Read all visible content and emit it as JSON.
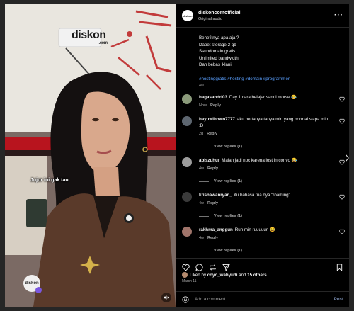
{
  "video": {
    "brand_logo_text": "diskon",
    "brand_logo_domain": ".com",
    "overlay_caption": "Jujur ini gak tau",
    "badge_text": "diskon"
  },
  "post": {
    "username": "diskoncomofficial",
    "audio": "Original audio",
    "caption_lines": [
      "Benefitnya apa aja ?",
      "Dapet storage 2 gb",
      "Ssubdomain gratis",
      "Unlimited bandwidth",
      "Dan bebas iklani"
    ],
    "hashtags": "#hostinggratis #hosting #domain #programmer",
    "caption_time": "4w"
  },
  "comments": [
    {
      "username": "bagasandri03",
      "text": "Day 1 cara belajar sandi morse 😂",
      "time": "Now",
      "reply": "Reply",
      "avatar_color": "#8a9a7a",
      "view_replies": null
    },
    {
      "username": "bayuwibowo7777",
      "text": "aku bertanya tanya min yang normal siapa min :D",
      "time": "2d",
      "reply": "Reply",
      "avatar_color": "#5d6670",
      "view_replies": "View replies (1)"
    },
    {
      "username": "abiszuhur",
      "text": "Malah jadi npc karena lost in convo 😂",
      "time": "4w",
      "reply": "Reply",
      "avatar_color": "#9c9c9c",
      "view_replies": "View replies (1)"
    },
    {
      "username": "krisnawanryan_",
      "text": "itu bahasa tua nya \"roaming\"",
      "time": "4w",
      "reply": "Reply",
      "avatar_color": "#3a3a3a",
      "view_replies": "View replies (1)"
    },
    {
      "username": "rakhma_anggun",
      "text": "Run min ruuuuun 😂",
      "time": "4w",
      "reply": "Reply",
      "avatar_color": "#a0746a",
      "view_replies": "View replies (1)"
    }
  ],
  "likes": {
    "prefix": "Liked by",
    "user": "coyo_wahyudi",
    "connector": "and",
    "others": "15 others"
  },
  "post_date": "March 11",
  "add_comment": {
    "placeholder": "Add a comment…",
    "post_label": "Post"
  },
  "colors": {
    "background": "#000000",
    "hashtag": "#5aa0ff",
    "muted": "#a8a8a8",
    "post_button": "#6d7fa0"
  }
}
